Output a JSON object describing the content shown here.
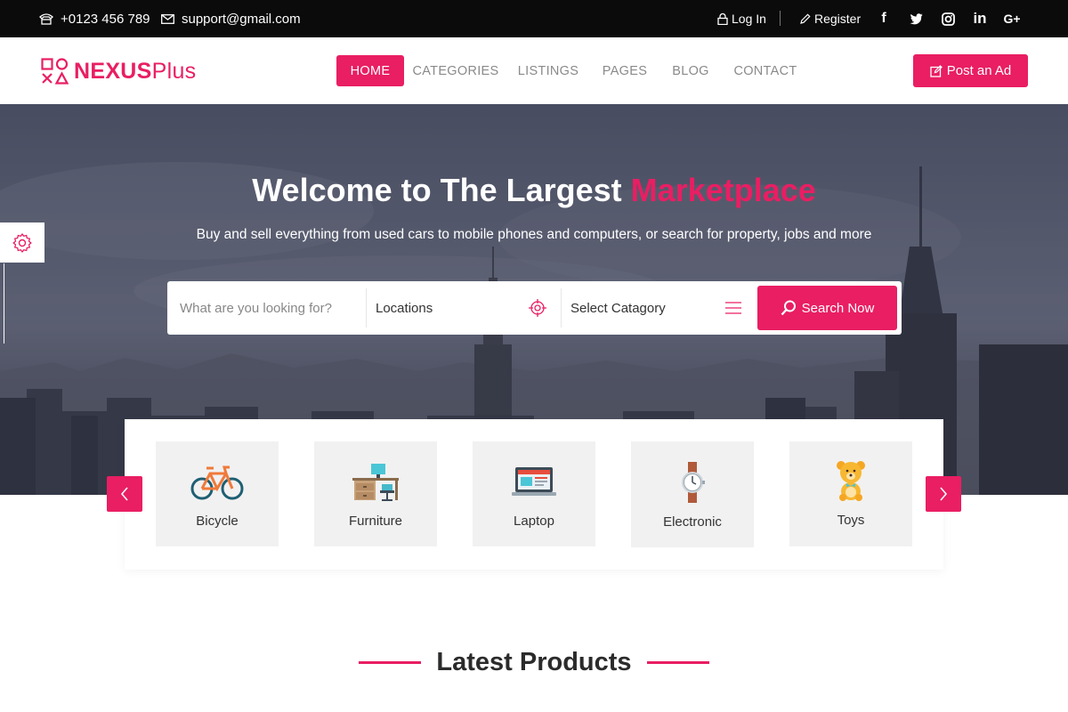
{
  "topbar": {
    "phone": "+0123 456 789",
    "email": "support@gmail.com",
    "login": "Log In",
    "register": "Register",
    "social": [
      "facebook-icon",
      "twitter-icon",
      "instagram-icon",
      "linkedin-icon",
      "google-plus-icon"
    ]
  },
  "brand": {
    "name_bold": "NEXUS",
    "name_light": "Plus"
  },
  "nav": {
    "home": "HOME",
    "categories": "CATEGORIES",
    "listings": "LISTINGS",
    "pages": "PAGES",
    "blog": "BLOG",
    "contact": "CONTACT"
  },
  "post_ad": "Post an Ad",
  "hero": {
    "title_main": "Welcome to The Largest ",
    "title_accent": "Marketplace",
    "subtitle": "Buy and sell everything from used cars to mobile phones and computers, or search for property, jobs and more"
  },
  "search": {
    "placeholder": "What are you looking for?",
    "location": "Locations",
    "category": "Select Catagory",
    "button": "Search Now"
  },
  "categories": [
    {
      "label": "Bicycle",
      "icon": "bicycle-icon"
    },
    {
      "label": "Furniture",
      "icon": "furniture-icon"
    },
    {
      "label": "Laptop",
      "icon": "laptop-icon"
    },
    {
      "label": "Electronic",
      "icon": "watch-icon"
    },
    {
      "label": "Toys",
      "icon": "teddy-bear-icon"
    }
  ],
  "section": {
    "title": "Latest Products"
  },
  "colors": {
    "accent": "#e91e63",
    "topbar": "#0b0b0b",
    "card_bg": "#f1f1f1"
  }
}
